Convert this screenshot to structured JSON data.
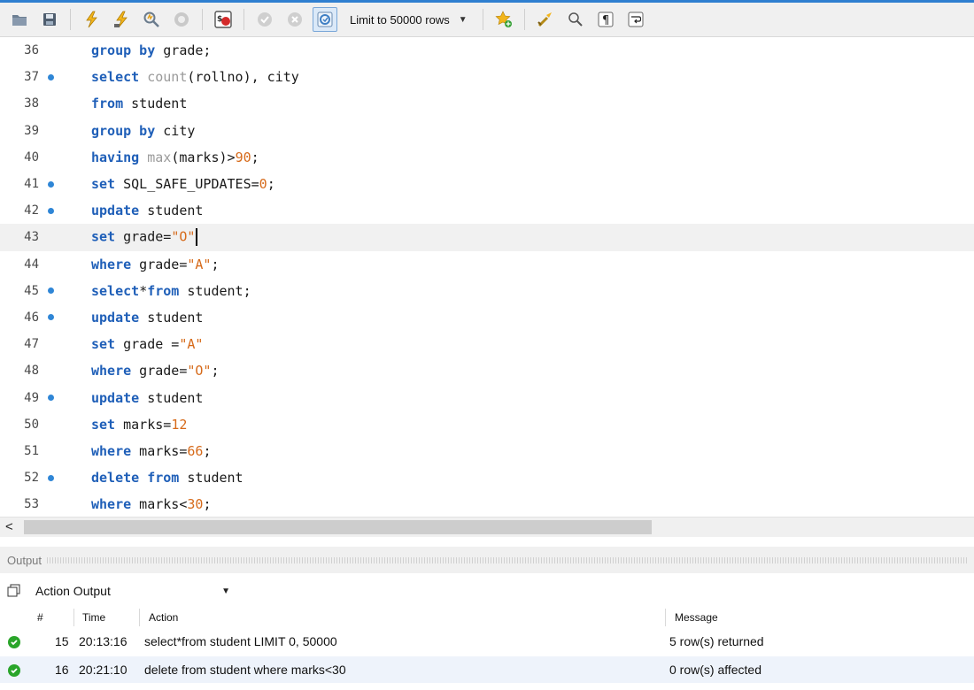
{
  "toolbar": {
    "limit_label": "Limit to 50000 rows",
    "icons": [
      "folder-icon",
      "save-icon",
      "execute-icon",
      "execute-current-icon",
      "explain-icon",
      "stop-icon",
      "stop-on-error-icon",
      "commit-icon",
      "rollback-icon",
      "autocommit-icon",
      "limit-dropdown",
      "add-snippet-icon",
      "beautify-icon",
      "find-icon",
      "invisible-chars-icon",
      "word-wrap-icon"
    ]
  },
  "editor": {
    "lines": [
      {
        "num": "36",
        "dot": false,
        "tokens": [
          [
            "kw",
            "group by"
          ],
          [
            "t",
            " grade;"
          ]
        ]
      },
      {
        "num": "37",
        "dot": true,
        "tokens": [
          [
            "kw",
            "select"
          ],
          [
            "t",
            " "
          ],
          [
            "fn",
            "count"
          ],
          [
            "t",
            "(rollno), city"
          ]
        ]
      },
      {
        "num": "38",
        "dot": false,
        "tokens": [
          [
            "kw",
            "from"
          ],
          [
            "t",
            " student"
          ]
        ]
      },
      {
        "num": "39",
        "dot": false,
        "tokens": [
          [
            "kw",
            "group by"
          ],
          [
            "t",
            " city"
          ]
        ]
      },
      {
        "num": "40",
        "dot": false,
        "tokens": [
          [
            "kw",
            "having"
          ],
          [
            "t",
            " "
          ],
          [
            "fn",
            "max"
          ],
          [
            "t",
            "(marks)>"
          ],
          [
            "num",
            "90"
          ],
          [
            "t",
            ";"
          ]
        ]
      },
      {
        "num": "41",
        "dot": true,
        "tokens": [
          [
            "kw",
            "set"
          ],
          [
            "t",
            " SQL_SAFE_UPDATES="
          ],
          [
            "num",
            "0"
          ],
          [
            "t",
            ";"
          ]
        ]
      },
      {
        "num": "42",
        "dot": true,
        "tokens": [
          [
            "kw",
            "update"
          ],
          [
            "t",
            " student"
          ]
        ]
      },
      {
        "num": "43",
        "dot": false,
        "current": true,
        "tokens": [
          [
            "kw",
            "set"
          ],
          [
            "t",
            " grade="
          ],
          [
            "str",
            "\"O\""
          ]
        ]
      },
      {
        "num": "44",
        "dot": false,
        "tokens": [
          [
            "kw",
            "where"
          ],
          [
            "t",
            " grade="
          ],
          [
            "str",
            "\"A\""
          ],
          [
            "t",
            ";"
          ]
        ]
      },
      {
        "num": "45",
        "dot": true,
        "tokens": [
          [
            "kw",
            "select"
          ],
          [
            "t",
            "*"
          ],
          [
            "kw",
            "from"
          ],
          [
            "t",
            " student;"
          ]
        ]
      },
      {
        "num": "46",
        "dot": true,
        "tokens": [
          [
            "kw",
            "update"
          ],
          [
            "t",
            " student"
          ]
        ]
      },
      {
        "num": "47",
        "dot": false,
        "tokens": [
          [
            "kw",
            "set"
          ],
          [
            "t",
            " grade ="
          ],
          [
            "str",
            "\"A\""
          ]
        ]
      },
      {
        "num": "48",
        "dot": false,
        "tokens": [
          [
            "kw",
            "where"
          ],
          [
            "t",
            " grade="
          ],
          [
            "str",
            "\"O\""
          ],
          [
            "t",
            ";"
          ]
        ]
      },
      {
        "num": "49",
        "dot": true,
        "tokens": [
          [
            "kw",
            "update"
          ],
          [
            "t",
            " student"
          ]
        ]
      },
      {
        "num": "50",
        "dot": false,
        "tokens": [
          [
            "kw",
            "set"
          ],
          [
            "t",
            " marks="
          ],
          [
            "num",
            "12"
          ]
        ]
      },
      {
        "num": "51",
        "dot": false,
        "tokens": [
          [
            "kw",
            "where"
          ],
          [
            "t",
            " marks="
          ],
          [
            "num",
            "66"
          ],
          [
            "t",
            ";"
          ]
        ]
      },
      {
        "num": "52",
        "dot": true,
        "tokens": [
          [
            "kw",
            "delete from"
          ],
          [
            "t",
            " student"
          ]
        ]
      },
      {
        "num": "53",
        "dot": false,
        "tokens": [
          [
            "kw",
            "where"
          ],
          [
            "t",
            " marks<"
          ],
          [
            "num",
            "30"
          ],
          [
            "t",
            ";"
          ]
        ]
      }
    ]
  },
  "output": {
    "title": "Output",
    "selector": "Action Output",
    "columns": {
      "num": "#",
      "time": "Time",
      "action": "Action",
      "message": "Message"
    },
    "rows": [
      {
        "num": "15",
        "time": "20:13:16",
        "action": "select*from student LIMIT 0, 50000",
        "message": "5 row(s) returned"
      },
      {
        "num": "16",
        "time": "20:21:10",
        "action": "delete from student where marks<30",
        "message": "0 row(s) affected"
      }
    ]
  },
  "colors": {
    "keyword": "#1f5fb8",
    "function": "#9a9a9a",
    "literal": "#d66a1a",
    "status_ok": "#2aa52a",
    "breakpoint": "#2f86d6"
  }
}
